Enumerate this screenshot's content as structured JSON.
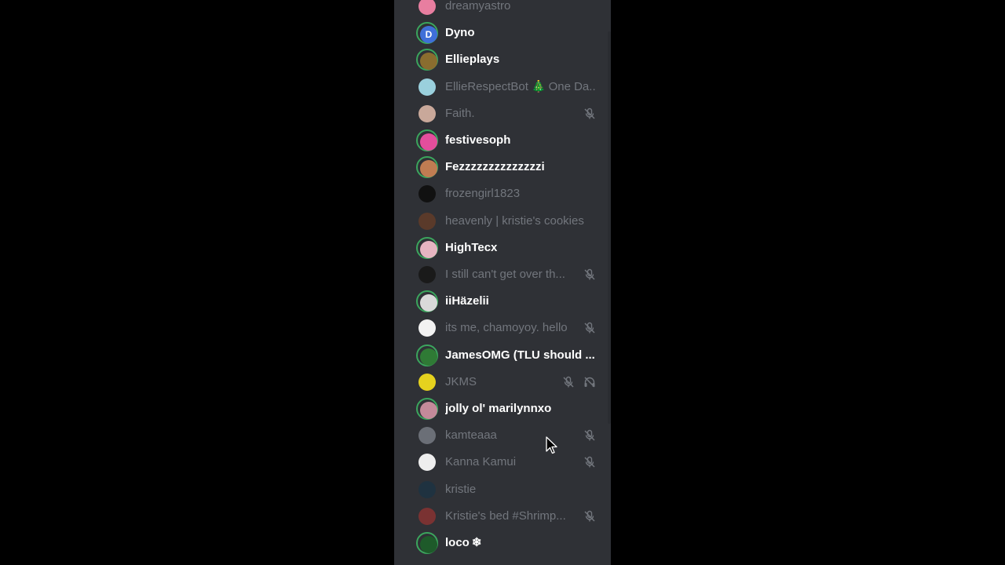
{
  "colors": {
    "panel_bg": "#2f3136",
    "speaking_ring": "#3ba55d",
    "active_name": "#ffffff",
    "idle_name": "#72767d",
    "muted_icon": "#72767d"
  },
  "members": [
    {
      "name": "dreamyastro",
      "active": false,
      "avatar_color": "#e87ea0",
      "avatar_letter": "",
      "muted": false,
      "deafened": false
    },
    {
      "name": "Dyno",
      "active": true,
      "avatar_color": "#3f6fd8",
      "avatar_letter": "D",
      "muted": false,
      "deafened": false
    },
    {
      "name": "Ellieplays",
      "active": true,
      "avatar_color": "#8a6d2f",
      "avatar_letter": "",
      "muted": false,
      "deafened": false
    },
    {
      "name": "EllieRespectBot",
      "active": false,
      "avatar_color": "#9ad0dd",
      "avatar_letter": "",
      "muted": false,
      "deafened": false,
      "suffix": "One Da..",
      "suffix_emoji": "🎄"
    },
    {
      "name": "Faith.",
      "active": false,
      "avatar_color": "#c9a89a",
      "avatar_letter": "",
      "muted": true,
      "deafened": false
    },
    {
      "name": "festivesoph",
      "active": true,
      "avatar_color": "#e44e9c",
      "avatar_letter": "",
      "muted": false,
      "deafened": false
    },
    {
      "name": "Fezzzzzzzzzzzzzzi",
      "active": true,
      "avatar_color": "#c07c52",
      "avatar_letter": "",
      "muted": false,
      "deafened": false
    },
    {
      "name": "frozengirl1823",
      "active": false,
      "avatar_color": "#111111",
      "avatar_letter": "",
      "muted": false,
      "deafened": false
    },
    {
      "name": "heavenly | kristie's cookies",
      "active": false,
      "avatar_color": "#5a3a2a",
      "avatar_letter": "",
      "muted": false,
      "deafened": false
    },
    {
      "name": "HighTecx",
      "active": true,
      "avatar_color": "#e6b5c1",
      "avatar_letter": "",
      "muted": false,
      "deafened": false
    },
    {
      "name": "I still can't get over th...",
      "active": false,
      "avatar_color": "#1a1a1a",
      "avatar_letter": "",
      "muted": true,
      "deafened": false
    },
    {
      "name": "iiHäzelii",
      "active": true,
      "avatar_color": "#d9d9d9",
      "avatar_letter": "",
      "muted": false,
      "deafened": false
    },
    {
      "name": "its me, chamoyoy. hello",
      "active": false,
      "avatar_color": "#f2f2f2",
      "avatar_letter": "",
      "muted": true,
      "deafened": false
    },
    {
      "name": "JamesOMG (TLU should ...",
      "active": true,
      "avatar_color": "#2f7a35",
      "avatar_letter": "",
      "muted": false,
      "deafened": false
    },
    {
      "name": "JKMS",
      "active": false,
      "avatar_color": "#e6d21e",
      "avatar_letter": "",
      "muted": true,
      "deafened": true
    },
    {
      "name": "jolly ol' marilynnxo",
      "active": true,
      "avatar_color": "#c48a9a",
      "avatar_letter": "",
      "muted": false,
      "deafened": false
    },
    {
      "name": "kamteaaa",
      "active": false,
      "avatar_color": "#6b6f77",
      "avatar_letter": "",
      "muted": true,
      "deafened": false
    },
    {
      "name": "Kanna Kamui",
      "active": false,
      "avatar_color": "#eeeeee",
      "avatar_letter": "",
      "muted": true,
      "deafened": false
    },
    {
      "name": "kristie",
      "active": false,
      "avatar_color": "#1f3240",
      "avatar_letter": "",
      "muted": false,
      "deafened": false
    },
    {
      "name": "Kristie's bed #Shrimp...",
      "active": false,
      "avatar_color": "#7a3232",
      "avatar_letter": "",
      "muted": true,
      "deafened": false
    },
    {
      "name": "loco",
      "active": true,
      "avatar_color": "#1e5a2a",
      "avatar_letter": "",
      "muted": false,
      "deafened": false,
      "suffix": "❄",
      "suffix_emoji": ""
    }
  ]
}
